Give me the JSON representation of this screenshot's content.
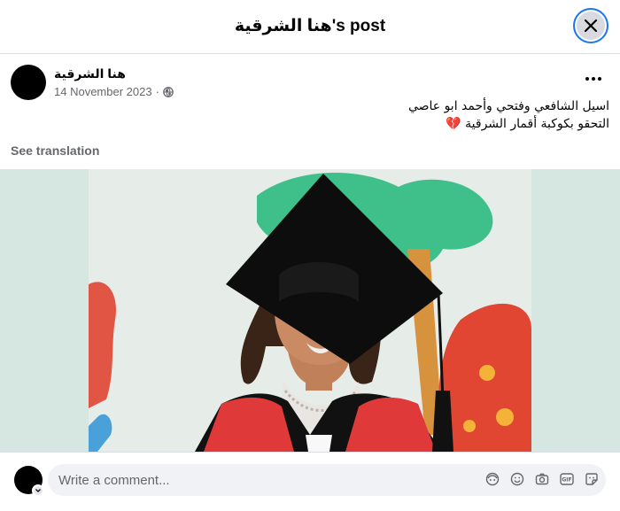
{
  "header": {
    "title": "هنا الشرقية's post",
    "close_icon": "close-icon"
  },
  "post": {
    "author": "هنا الشرقية",
    "date": "14 November 2023",
    "privacy_icon": "globe-icon",
    "more_icon": "more-options-icon",
    "text_line_1": "اسيل  الشافعي وفتحي وأحمد ابو عاصي",
    "text_line_2": "التحقو بكوكبة أقمار الشرقية",
    "text_emoji": "💔",
    "see_translation": "See translation"
  },
  "photo": {
    "description_icon": "graduation-photo"
  },
  "comment": {
    "placeholder": "Write a comment...",
    "icons": [
      "avatar-sticker-icon",
      "emoji-icon",
      "camera-icon",
      "gif-icon",
      "sticker-icon"
    ]
  },
  "colors": {
    "accent": "#1877f2",
    "secondary_text": "#65676b",
    "divider": "#dadde1",
    "input_bg": "#f0f2f5"
  }
}
